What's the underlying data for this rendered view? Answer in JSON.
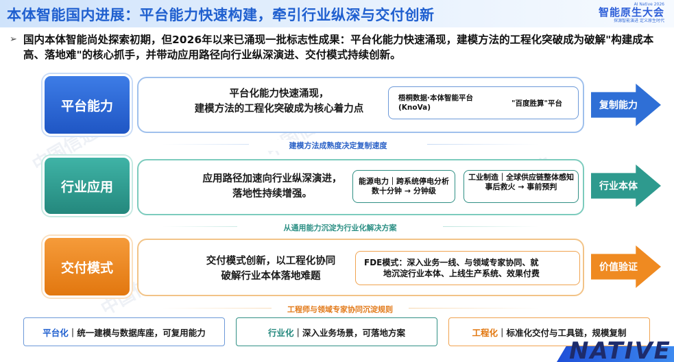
{
  "header": {
    "title": "本体智能国内进展：平台能力快速构建，牵引行业纵深与交付创新",
    "brand_top": "AI Native 2026",
    "brand_main": "智能原生大会",
    "brand_sub": "探源智能演进  定义原生时代"
  },
  "intro": {
    "bullet": "➢",
    "text": "国内本体智能尚处探索初期，但2026年以来已涌现一批标志性成果：平台化能力快速涌现，建模方法的工程化突破成为破解\"构建成本高、落地难\"的核心抓手，并带动应用路径向行业纵深演进、交付模式持续创新。"
  },
  "rows": [
    {
      "label": "平台能力",
      "text_line1": "平台化能力快速涌现，",
      "text_line2": "建模方法的工程化突破成为核心着力点",
      "pill_left": "梧桐数据·本体智能平台(KnoVa)",
      "pill_right": "\"百度胜算\"平台",
      "arrow": "复制能力"
    },
    {
      "label": "行业应用",
      "text_line1": "应用路径加速向行业纵深演进，",
      "text_line2": "落地性持续增强。",
      "pill_left_line1": "能源电力｜跨系统停电分析",
      "pill_left_line2": "数十分钟 → 分钟级",
      "pill_right_line1": "工业制造｜全球供应链整体感知",
      "pill_right_line2": "事后救火 → 事前预判",
      "arrow": "行业本体"
    },
    {
      "label": "交付模式",
      "text_line1": "交付模式创新，以工程化协同",
      "text_line2": "破解行业本体落地难题",
      "pill_line1": "FDE模式：深入业务一线、与领域专家协同、就",
      "pill_line2": "地沉淀行业本体、上线生产系统、效果付费",
      "arrow": "价值验证"
    }
  ],
  "separators": [
    "建模方法成熟度决定复制速度",
    "从通用能力沉淀为行业化解决方案",
    "工程师与领域专家协同沉淀规则"
  ],
  "bottom": [
    {
      "keyword": "平台化",
      "rest": "｜统一建模与数据库座，可复用能力"
    },
    {
      "keyword": "行业化",
      "rest": "｜深入业务场景，可落地方案"
    },
    {
      "keyword": "工程化",
      "rest": "｜标准化交付与工具链，规模复制"
    }
  ],
  "watermark": "中国信通院",
  "footer_logo": "NATIVE",
  "colors": {
    "blue": "#1f5fcf",
    "teal": "#24887d",
    "orange": "#e2770f"
  }
}
